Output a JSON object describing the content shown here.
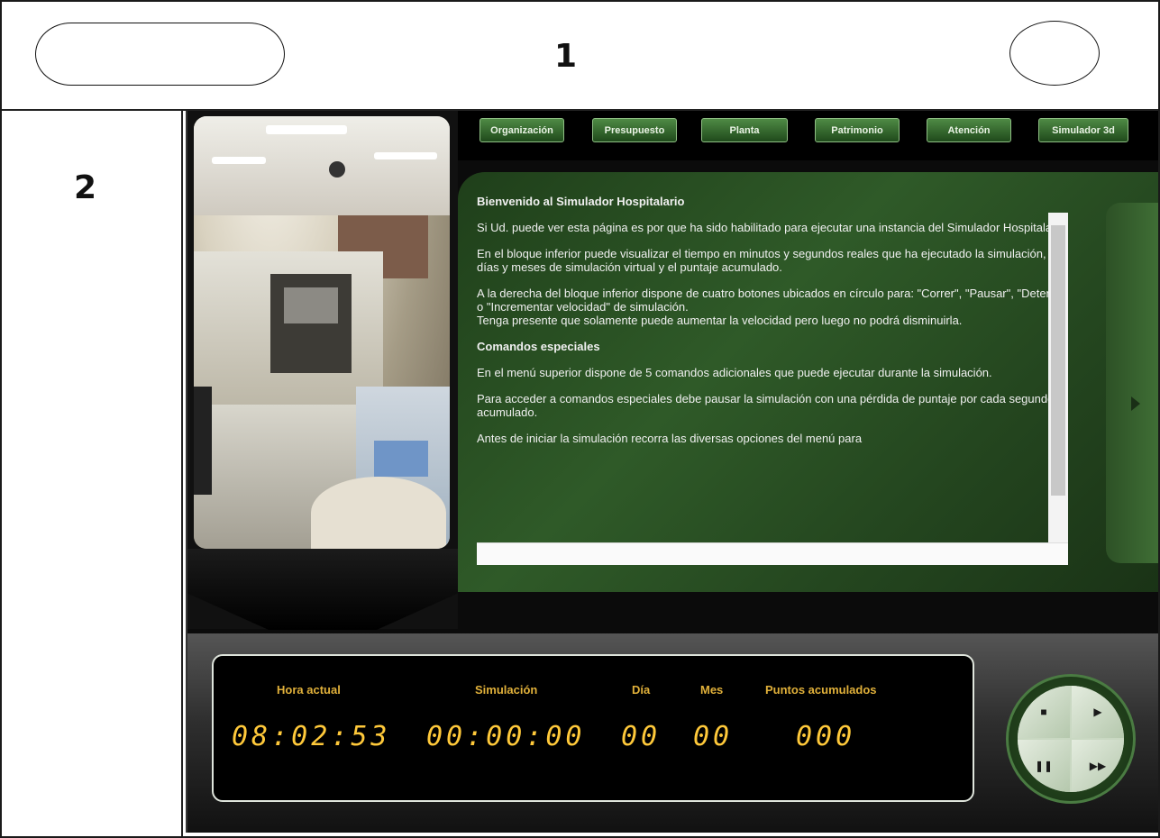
{
  "wireframe": {
    "label_top": "1",
    "label_left": "2"
  },
  "nav": {
    "items": [
      {
        "label": "Organización"
      },
      {
        "label": "Presupuesto"
      },
      {
        "label": "Planta"
      },
      {
        "label": "Patrimonio"
      },
      {
        "label": "Atención"
      },
      {
        "label": "Simulador 3d"
      }
    ]
  },
  "content": {
    "title": "Bienvenido al Simulador Hospitalario",
    "p1": "Si Ud. puede ver esta página es por que ha sido habilitado para ejecutar una instancia del Simulador Hospitalario.",
    "p2": "En el bloque inferior puede visualizar el tiempo en minutos y segundos reales que ha ejecutado la simulación, los días y meses de simulación virtual y el puntaje acumulado.",
    "p3": "A la derecha del bloque inferior dispone de cuatro botones ubicados en círculo para: \"Correr\", \"Pausar\", \"Detener\" o \"Incrementar velocidad\" de simulación.",
    "p3b": "Tenga presente que solamente puede aumentar la velocidad pero luego no podrá disminuirla.",
    "heading2": "Comandos especiales",
    "p4": "En el menú superior dispone de 5 comandos adicionales que puede ejecutar durante la simulación.",
    "p5": "Para acceder a comandos especiales debe pausar la simulación con una pérdida de puntaje por cada segundo acumulado.",
    "p6": "Antes de iniciar la simulación recorra las diversas opciones del menú para"
  },
  "readout": {
    "labels": {
      "hora": "Hora actual",
      "sim": "Simulación",
      "dia": "Día",
      "mes": "Mes",
      "puntos": "Puntos acumulados"
    },
    "values": {
      "hora": "08:02:53",
      "sim": "00:00:00",
      "dia": "00",
      "mes": "00",
      "puntos": "000"
    }
  },
  "controls": {
    "stop": "■",
    "play": "▶",
    "pause": "❚❚",
    "fast": "▶▶"
  }
}
